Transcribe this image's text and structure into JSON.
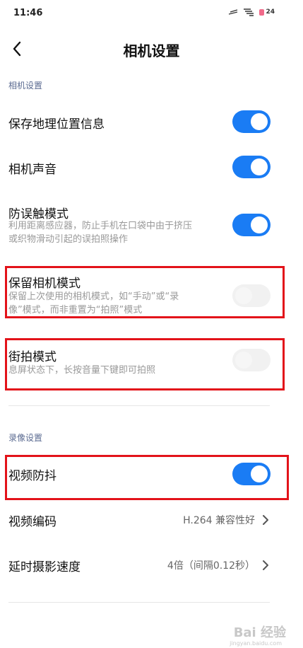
{
  "status": {
    "time": "11:46",
    "battery": "24",
    "icons": [
      "signal-icon",
      "wifi-icon",
      "battery-icon"
    ]
  },
  "header": {
    "title": "相机设置"
  },
  "sections": {
    "camera": "相机设置",
    "video": "录像设置"
  },
  "camera_settings": {
    "geo": {
      "title": "保存地理位置信息",
      "enabled": true
    },
    "sound": {
      "title": "相机声音",
      "enabled": true
    },
    "anti_touch": {
      "title": "防误触模式",
      "subtitle_line1": "利用距离感应器，防止手机在口袋中由于挤压",
      "subtitle_line2": "或织物滑动引起的误拍照操作",
      "enabled": true
    },
    "keep_mode": {
      "title": "保留相机模式",
      "subtitle_line1": "保留上次使用的相机模式，如“手动”或“录",
      "subtitle_line2": "像”模式，而非重置为“拍照”模式",
      "enabled": false
    },
    "street_mode": {
      "title": "街拍模式",
      "subtitle": "息屏状态下，长按音量下键即可拍照",
      "enabled": false
    }
  },
  "video_settings": {
    "stabilization": {
      "title": "视频防抖",
      "enabled": true
    },
    "encoding": {
      "title": "视频编码",
      "value": "H.264 兼容性好"
    },
    "timelapse": {
      "title": "延时摄影速度",
      "value": "4倍（间隔0.12秒）"
    }
  },
  "watermark": {
    "brand": "Bai 经验",
    "url": "jingyan.baidu.com"
  },
  "colors": {
    "accent": "#1a7cf4",
    "highlight": "#e3131a",
    "section": "#5b6b91"
  }
}
